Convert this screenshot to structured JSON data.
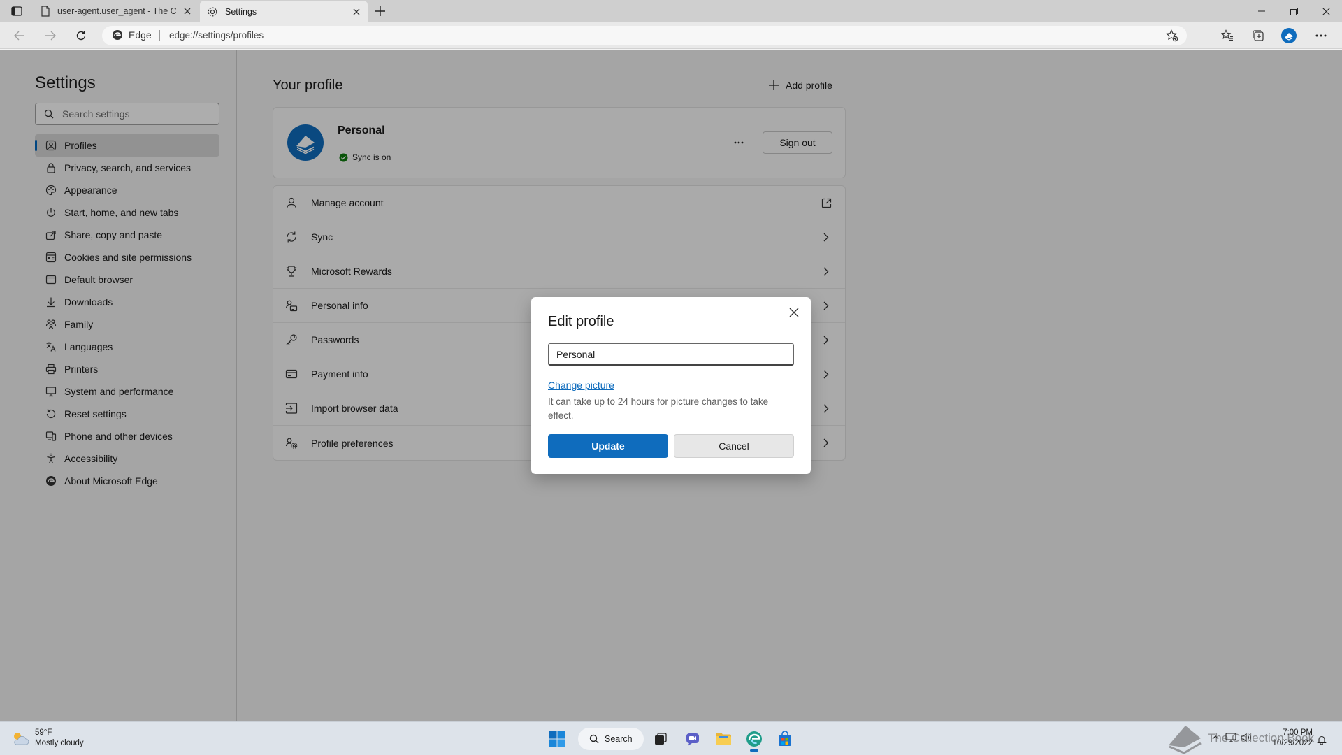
{
  "browser": {
    "tabs": [
      {
        "title": "user-agent.user_agent - The Coll"
      },
      {
        "title": "Settings"
      }
    ],
    "address": {
      "site_label": "Edge",
      "url": "edge://settings/profiles"
    }
  },
  "sidebar": {
    "title": "Settings",
    "search_placeholder": "Search settings",
    "items": [
      {
        "label": "Profiles",
        "icon": "profile-icon"
      },
      {
        "label": "Privacy, search, and services",
        "icon": "lock-icon"
      },
      {
        "label": "Appearance",
        "icon": "palette-icon"
      },
      {
        "label": "Start, home, and new tabs",
        "icon": "power-icon"
      },
      {
        "label": "Share, copy and paste",
        "icon": "share-icon"
      },
      {
        "label": "Cookies and site permissions",
        "icon": "site-permissions-icon"
      },
      {
        "label": "Default browser",
        "icon": "browser-icon"
      },
      {
        "label": "Downloads",
        "icon": "download-icon"
      },
      {
        "label": "Family",
        "icon": "family-icon"
      },
      {
        "label": "Languages",
        "icon": "languages-icon"
      },
      {
        "label": "Printers",
        "icon": "printer-icon"
      },
      {
        "label": "System and performance",
        "icon": "computer-icon"
      },
      {
        "label": "Reset settings",
        "icon": "reset-icon"
      },
      {
        "label": "Phone and other devices",
        "icon": "phone-icon"
      },
      {
        "label": "Accessibility",
        "icon": "accessibility-icon"
      },
      {
        "label": "About Microsoft Edge",
        "icon": "edge-icon"
      }
    ]
  },
  "main": {
    "heading": "Your profile",
    "add_profile": "Add profile",
    "profile": {
      "name": "Personal",
      "sync_status": "Sync is on",
      "sign_out": "Sign out"
    },
    "rows": [
      {
        "label": "Manage account",
        "icon": "person-icon",
        "action": "external-link-icon"
      },
      {
        "label": "Sync",
        "icon": "sync-icon",
        "action": "chevron-right-icon"
      },
      {
        "label": "Microsoft Rewards",
        "icon": "trophy-icon",
        "action": "chevron-right-icon"
      },
      {
        "label": "Personal info",
        "icon": "contact-card-icon",
        "action": "chevron-right-icon"
      },
      {
        "label": "Passwords",
        "icon": "key-icon",
        "action": "chevron-right-icon"
      },
      {
        "label": "Payment info",
        "icon": "credit-card-icon",
        "action": "chevron-right-icon"
      },
      {
        "label": "Import browser data",
        "icon": "import-icon",
        "action": "chevron-right-icon"
      },
      {
        "label": "Profile preferences",
        "icon": "people-settings-icon",
        "action": "chevron-right-icon"
      }
    ]
  },
  "dialog": {
    "title": "Edit profile",
    "name_value": "Personal",
    "change_picture": "Change picture",
    "note": "It can take up to 24 hours for picture changes to take effect.",
    "update": "Update",
    "cancel": "Cancel"
  },
  "taskbar": {
    "weather_temp": "59°F",
    "weather_desc": "Mostly cloudy",
    "search_label": "Search",
    "time": "7:00 PM",
    "date": "10/29/2022",
    "watermark": "The Collection Book"
  },
  "colors": {
    "accent": "#0f6cbd",
    "sync_ok": "#107c10"
  }
}
